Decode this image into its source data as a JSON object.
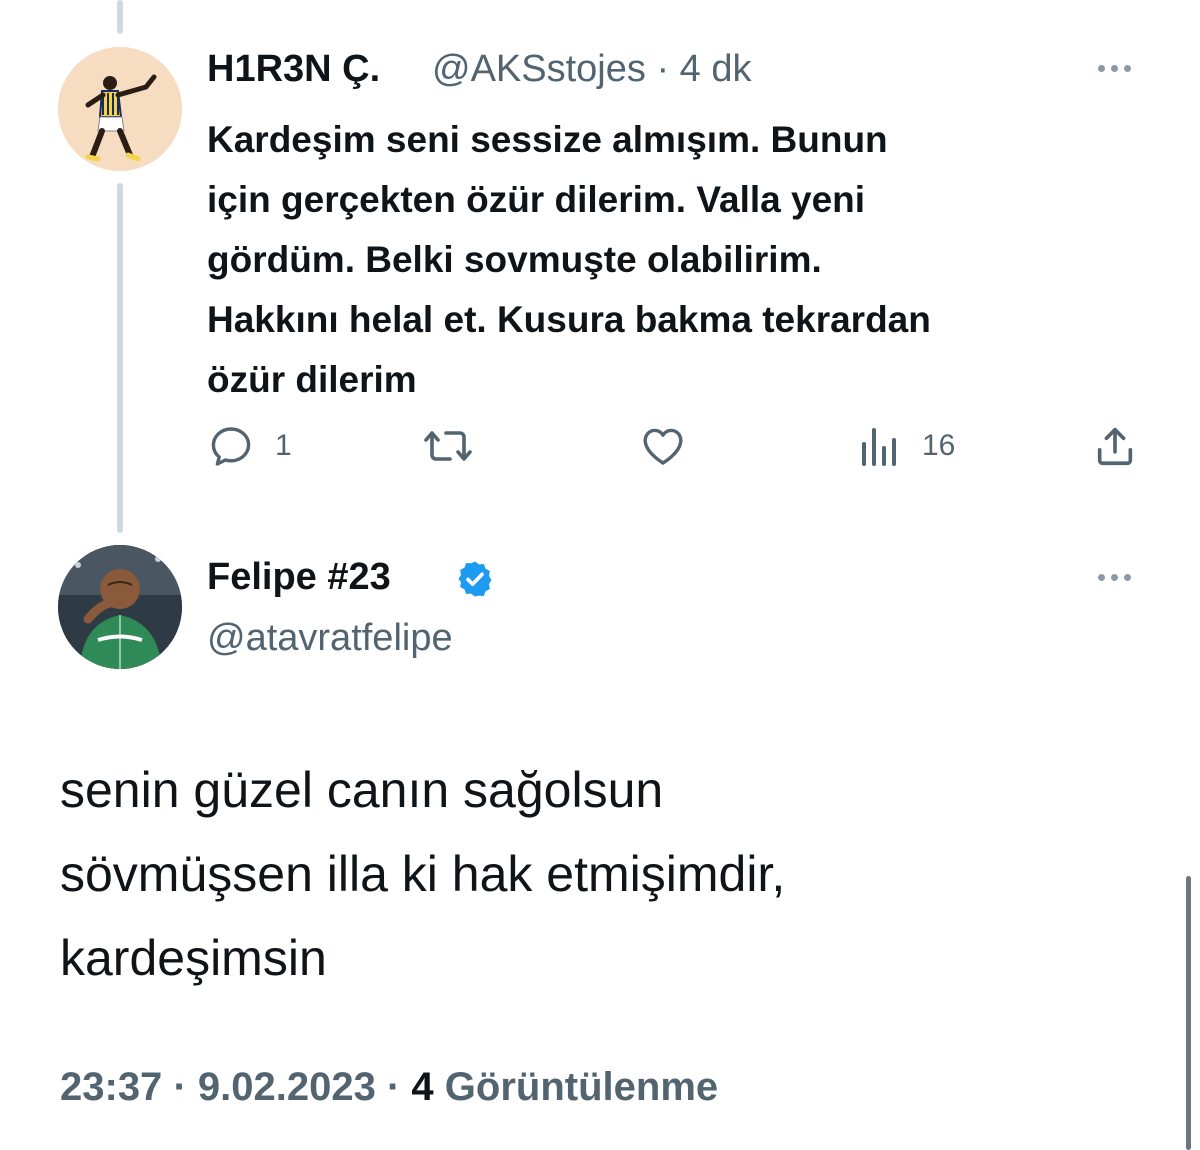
{
  "reply_tweet": {
    "display_name": "H1R3N Ç.",
    "handle": "@AKSstojes",
    "separator": "·",
    "time_ago": "4 dk",
    "text": "Kardeşim seni sessize almışım. Bunun\niçin gerçekten özür dilerim. Valla yeni\ngördüm. Belki sovmuşte olabilirim.\nHakkını helal et. Kusura bakma tekrardan\nözür dilerim",
    "actions": {
      "reply_count": "1",
      "views_count": "16"
    },
    "icons": [
      "reply-icon",
      "retweet-icon",
      "like-icon",
      "views-icon",
      "share-icon",
      "more-icon"
    ]
  },
  "main_tweet": {
    "display_name": "Felipe #23",
    "handle": "@atavratfelipe",
    "verified": true,
    "text": "senin güzel canın sağolsun\nsövmüşsen illa ki hak etmişimdir,\nkardeşimsin",
    "time": "23:37",
    "date": "9.02.2023",
    "separator": "·",
    "views_count": "4",
    "views_label": "Görüntülenme"
  },
  "colors": {
    "text_primary": "#0f1419",
    "text_secondary": "#536471",
    "thread_line": "#cfd9de",
    "verified_blue": "#1d9bf0"
  }
}
